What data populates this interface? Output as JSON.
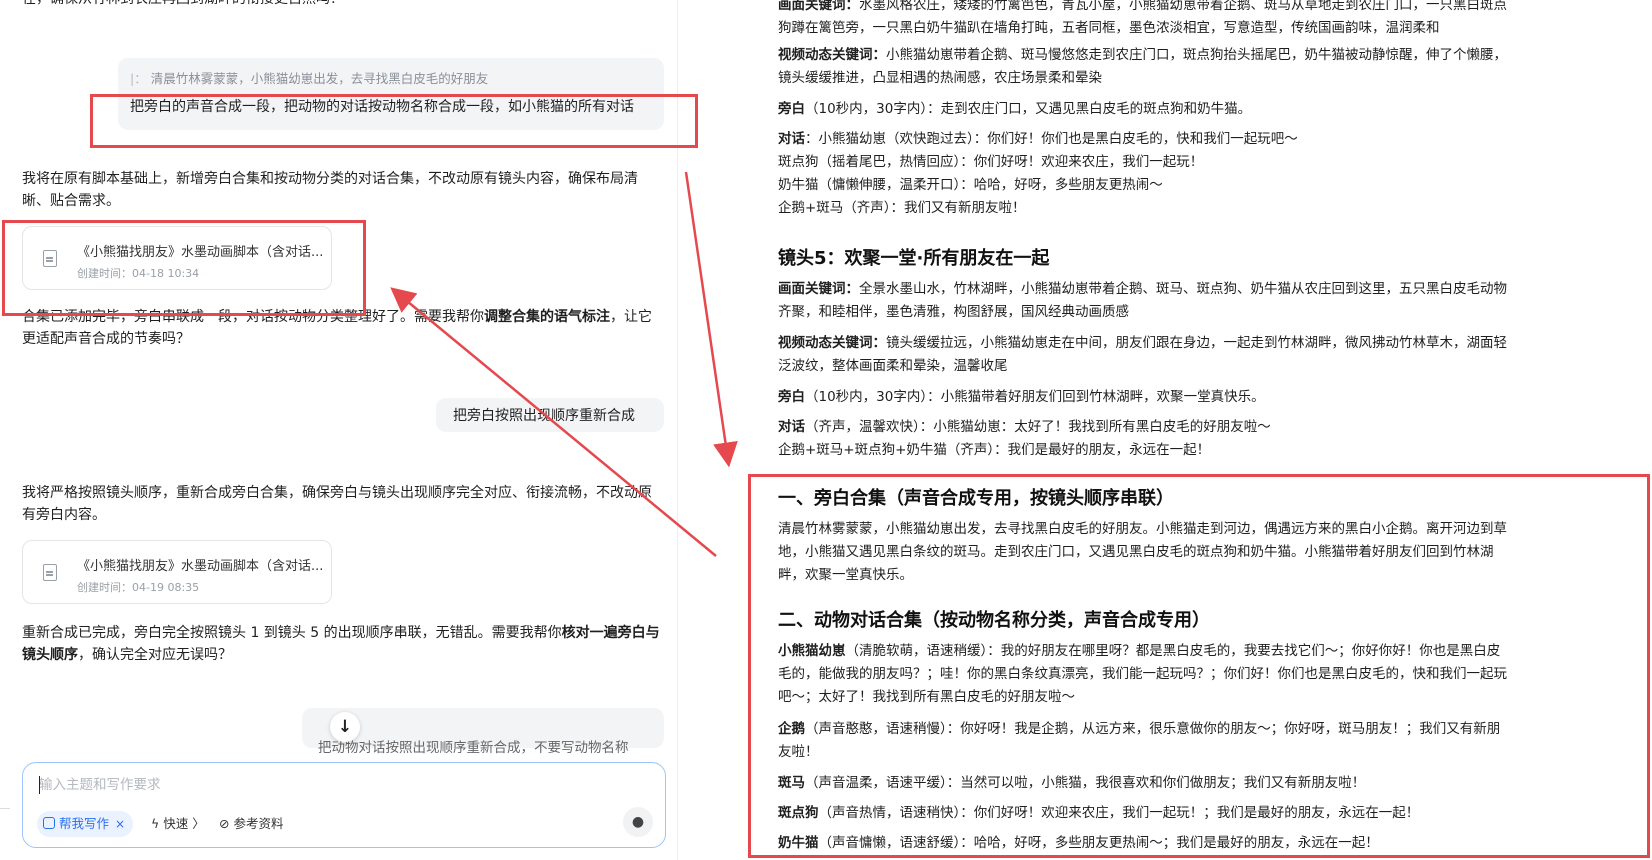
{
  "chat": {
    "top_fragment": "在，确保从竹林到农庄再回到湖畔的衔接更自然吗？",
    "quote_text": "清晨竹林雾蒙蒙，小熊猫幼崽出发，去寻找黑白皮毛的好朋友",
    "user_msg_1": "把旁白的声音合成一段，把动物的对话按动物名称合成一段，如小熊猫的所有对话",
    "reply_1": "我将在原有脚本基础上，新增旁白合集和按动物分类的对话合集，不改动原有镜头内容，确保布局清晰、贴合需求。",
    "card_1": {
      "title": "《小熊猫找朋友》水墨动画脚本（含对话...",
      "date": "创建时间：04-18 10:34"
    },
    "reply_2_pre": "合集已添加完毕，旁白串联成一段，对话按动物分类整理好了。需要我帮你",
    "reply_2_bold": "调整合集的语气标注",
    "reply_2_post": "，让它更适配声音合成的节奏吗？",
    "user_msg_2": "把旁白按照出现顺序重新合成",
    "reply_3": "我将严格按照镜头顺序，重新合成旁白合集，确保旁白与镜头出现顺序完全对应、衔接流畅，不改动原有旁白内容。",
    "card_2": {
      "title": "《小熊猫找朋友》水墨动画脚本（含对话...",
      "date": "创建时间：04-19 08:35"
    },
    "reply_4_pre": "重新合成已完成，旁白完全按照镜头 1 到镜头 5 的出现顺序串联，无错乱。需要我帮你",
    "reply_4_bold": "核对一遍旁白与镜头顺序",
    "reply_4_post": "，确认完全对应无误吗？",
    "user_msg_3": "把动物对话按照出现顺序重新合成，不要写动物名称",
    "scroll_down_icon": "arrow-down-icon",
    "input_placeholder": "输入主题和写作要求",
    "chip_label": "帮我写作",
    "tool_fast": "快速",
    "tool_ref": "参考资料"
  },
  "doc": {
    "l1_label": "画面关键词：",
    "l1_a": "水墨风格农庄，矮矮的竹篱笆色，青瓦小屋，小熊猫幼崽带着企鹅、斑马从草地走到农庄门口，一只黑白斑点",
    "l1_b": "狗蹲在篱笆旁，一只黑白奶牛猫趴在墙角打盹，五者同框，墨色浓淡相宜，写意造型，传统国画韵味，温润柔和",
    "l2_label": "视频动态关键词：",
    "l2_a": "小熊猫幼崽带着企鹅、斑马慢悠悠走到农庄门口，斑点狗抬头摇尾巴，奶牛猫被动静惊醒，伸了个懒腰，",
    "l2_b": "镜头缓缓推进，凸显相遇的热闹感，农庄场景柔和晕染",
    "l3_label": "旁白",
    "l3_text": "（10秒内，30字内）：走到农庄门口，又遇见黑白皮毛的斑点狗和奶牛猫。",
    "l4_label": "对话",
    "l4_text": "：小熊猫幼崽（欢快跑过去）：你们好！你们也是黑白皮毛的，快和我们一起玩吧～",
    "l5": "斑点狗（摇着尾巴，热情回应）：你们好呀！欢迎来农庄，我们一起玩！",
    "l6": "奶牛猫（慵懒伸腰，温柔开口）：哈哈，好呀，多些朋友更热闹～",
    "l7": "企鹅+斑马（齐声）：我们又有新朋友啦！",
    "shot5_title": "镜头5：欢聚一堂·所有朋友在一起",
    "s5_1_label": "画面关键词：",
    "s5_1_a": "全景水墨山水，竹林湖畔，小熊猫幼崽带着企鹅、斑马、斑点狗、奶牛猫从农庄回到这里，五只黑白皮毛动物",
    "s5_1_b": "齐聚，和睦相伴，墨色清雅，构图舒展，国风经典动画质感",
    "s5_2_label": "视频动态关键词：",
    "s5_2_a": "镜头缓缓拉远，小熊猫幼崽走在中间，朋友们跟在身边，一起走到竹林湖畔，微风拂动竹林草木，湖面轻",
    "s5_2_b": "泛波纹，整体画面柔和晕染，温馨收尾",
    "s5_3_label": "旁白",
    "s5_3_text": "（10秒内，30字内）：小熊猫带着好朋友们回到竹林湖畔，欢聚一堂真快乐。",
    "s5_4_label": "对话",
    "s5_4_text": "（齐声，温馨欢快）：小熊猫幼崽：太好了！我找到所有黑白皮毛的好朋友啦～",
    "s5_5": "企鹅+斑马+斑点狗+奶牛猫（齐声）：我们是最好的朋友，永远在一起！",
    "sec1_title": "一、旁白合集（声音合成专用，按镜头顺序串联）",
    "sec1_a": "清晨竹林雾蒙蒙，小熊猫幼崽出发，去寻找黑白皮毛的好朋友。小熊猫走到河边，偶遇远方来的黑白小企鹅。离开河边到草",
    "sec1_b": "地，小熊猫又遇见黑白条纹的斑马。走到农庄门口，又遇见黑白皮毛的斑点狗和奶牛猫。小熊猫带着好朋友们回到竹林湖",
    "sec1_c": "畔，欢聚一堂真快乐。",
    "sec2_title": "二、动物对话合集（按动物名称分类，声音合成专用）",
    "a1_label": "小熊猫幼崽",
    "a1_a": "（清脆软萌，语速稍缓）：我的好朋友在哪里呀？都是黑白皮毛的，我要去找它们～；你好你好！你也是黑白皮",
    "a1_b": "毛的，能做我的朋友吗？；哇！你的黑白条纹真漂亮，我们能一起玩吗？；你们好！你们也是黑白皮毛的，快和我们一起玩",
    "a1_c": "吧～；太好了！我找到所有黑白皮毛的好朋友啦～",
    "a2_label": "企鹅",
    "a2_a": "（声音憨憨，语速稍慢）：你好呀！我是企鹅，从远方来，很乐意做你的朋友～；你好呀，斑马朋友！；我们又有新朋",
    "a2_b": "友啦！",
    "a3_label": "斑马",
    "a3_text": "（声音温柔，语速平缓）：当然可以啦，小熊猫，我很喜欢和你们做朋友；我们又有新朋友啦！",
    "a4_label": "斑点狗",
    "a4_text": "（声音热情，语速稍快）：你们好呀！欢迎来农庄，我们一起玩！；我们是最好的朋友，永远在一起！",
    "a5_label": "奶牛猫",
    "a5_text": "（声音慵懒，语速舒缓）：哈哈，好呀，多些朋友更热闹～；我们是最好的朋友，永远在一起！"
  },
  "colors": {
    "highlight": "#e5484d",
    "accent": "#2a6ff0",
    "input_border": "#9ec3fb"
  }
}
